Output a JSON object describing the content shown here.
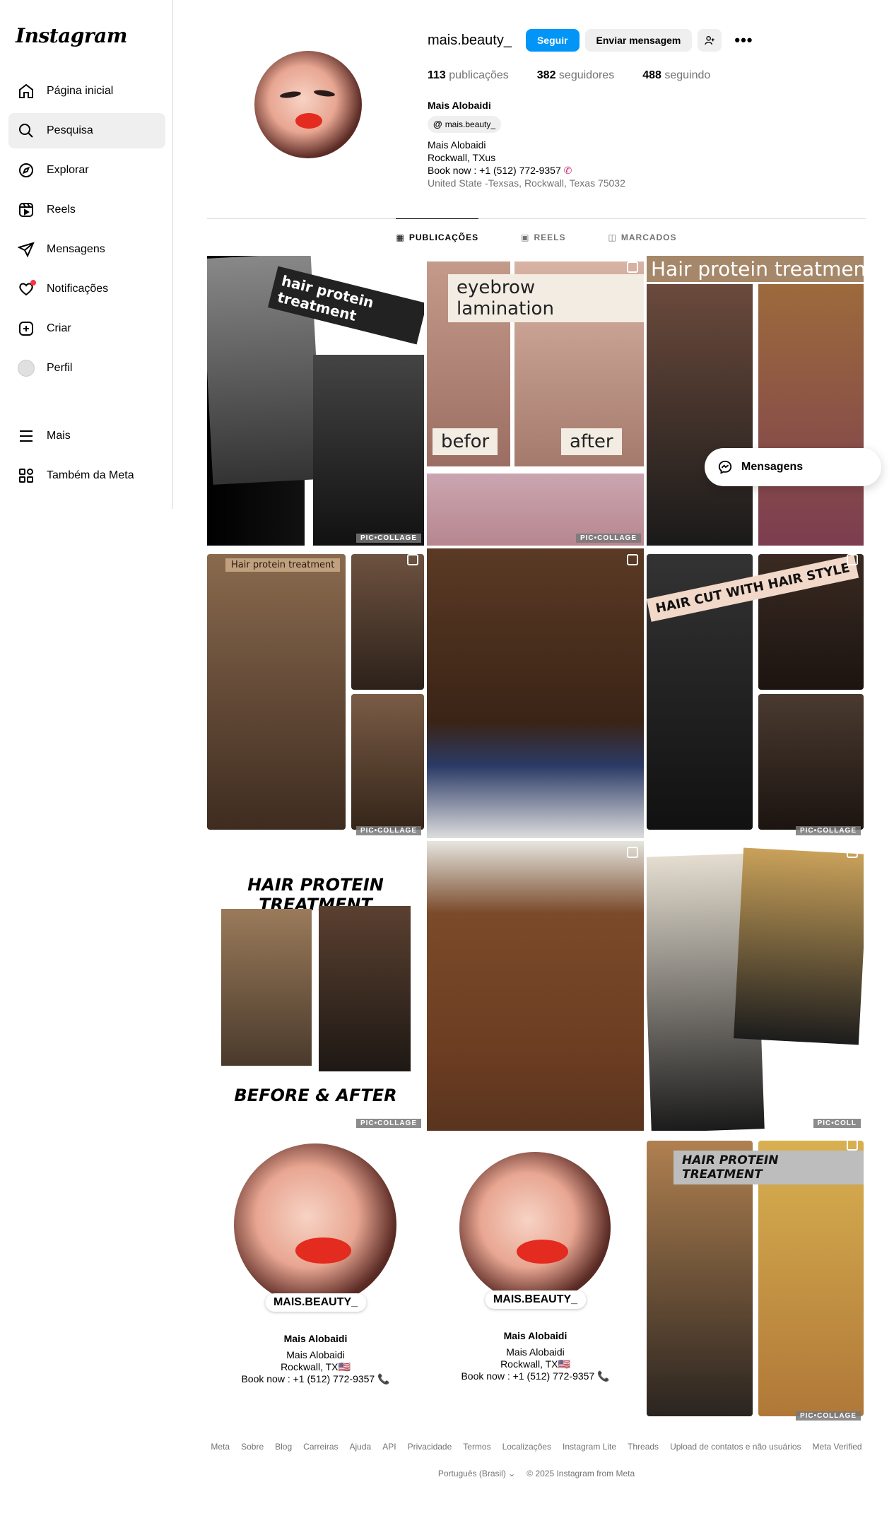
{
  "app": {
    "logo": "Instagram"
  },
  "sidebar": {
    "items": [
      {
        "label": "Página inicial",
        "icon": "home-icon"
      },
      {
        "label": "Pesquisa",
        "icon": "search-icon"
      },
      {
        "label": "Explorar",
        "icon": "compass-icon"
      },
      {
        "label": "Reels",
        "icon": "reels-icon"
      },
      {
        "label": "Mensagens",
        "icon": "send-icon"
      },
      {
        "label": "Notificações",
        "icon": "heart-icon"
      },
      {
        "label": "Criar",
        "icon": "plus-square-icon"
      },
      {
        "label": "Perfil",
        "icon": "avatar"
      }
    ],
    "bottom_items": [
      {
        "label": "Mais",
        "icon": "menu-icon"
      },
      {
        "label": "Também da Meta",
        "icon": "meta-apps-icon"
      }
    ]
  },
  "profile": {
    "username": "mais.beauty_",
    "follow_label": "Seguir",
    "message_label": "Enviar mensagem",
    "stats": {
      "posts_count": "113",
      "posts_label": "publicações",
      "followers_count": "382",
      "followers_label": "seguidores",
      "following_count": "488",
      "following_label": "seguindo"
    },
    "bio": {
      "name": "Mais Alobaidi",
      "threads_handle": "mais.beauty_",
      "line1": "Mais Alobaidi",
      "line2": "Rockwall, TXus",
      "line3": "Book now : +1 (512) 772-9357",
      "address": "United State -Texsas, Rockwall, Texas 75032"
    }
  },
  "tabs": [
    {
      "label": "PUBLICAÇÕES",
      "active": true
    },
    {
      "label": "REELS",
      "active": false
    },
    {
      "label": "MARCADOS",
      "active": false
    }
  ],
  "posts": {
    "p1_caption": "hair protein treatment",
    "p2_title": "eyebrow lamination",
    "p2_before": "befor",
    "p2_after": "after",
    "p3_title": "Hair protein treatment",
    "p4_caption": "Hair protein treatment",
    "p6_caption": "HAIR CUT WITH HAIR STYLE",
    "p7_title": "HAIR PROTEIN TREATMENT",
    "p7_sub": "BEFORE & AFTER",
    "p10_handle": "MAIS.BEAUTY_",
    "p10_name": "Mais Alobaidi",
    "p10_l1": "Mais Alobaidi",
    "p10_l2": "Rockwall, TX🇺🇸",
    "p10_l3": "Book now : +1 (512) 772-9357 📞",
    "p11_handle": "MAIS.BEAUTY_",
    "p11_name": "Mais Alobaidi",
    "p11_l1": "Mais Alobaidi",
    "p11_l2": "Rockwall, TX🇺🇸",
    "p11_l3": "Book now : +1 (512) 772-9357 📞",
    "p12_title": "HAIR PROTEIN TREATMENT",
    "watermark": "PIC•COLLAGE",
    "watermark_cut": "PIC•COLL"
  },
  "messages_float": {
    "label": "Mensagens"
  },
  "footer": {
    "links": [
      "Meta",
      "Sobre",
      "Blog",
      "Carreiras",
      "Ajuda",
      "API",
      "Privacidade",
      "Termos",
      "Localizações",
      "Instagram Lite",
      "Threads",
      "Upload de contatos e não usuários",
      "Meta Verified"
    ],
    "language": "Português (Brasil)",
    "copyright": "© 2025 Instagram from Meta"
  },
  "colors": {
    "accent": "#0095f6",
    "notification": "#ff3040"
  }
}
